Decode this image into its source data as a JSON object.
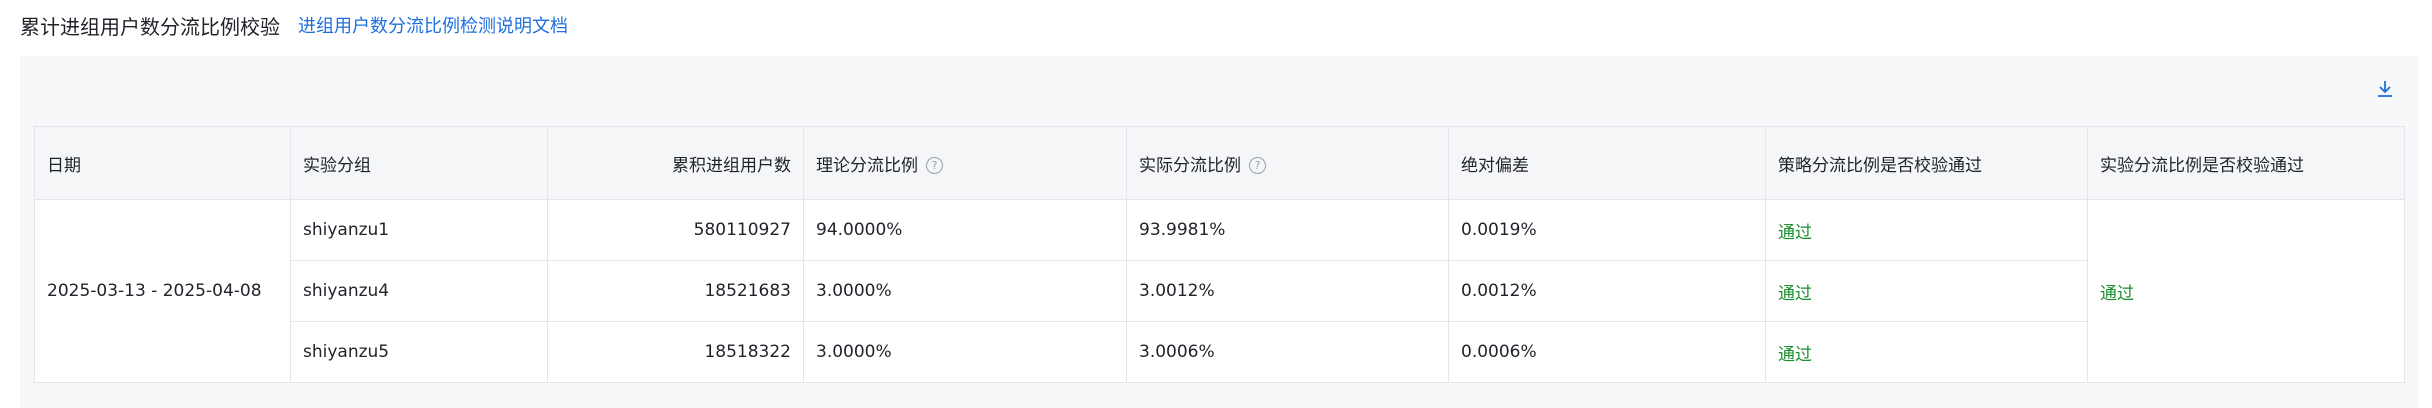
{
  "header": {
    "title": "累计进组用户数分流比例校验",
    "doc_link": "进组用户数分流比例检测说明文档"
  },
  "table": {
    "columns": [
      "日期",
      "实验分组",
      "累积进组用户数",
      "理论分流比例",
      "实际分流比例",
      "绝对偏差",
      "策略分流比例是否校验通过",
      "实验分流比例是否校验通过"
    ],
    "date_range": "2025-03-13 - 2025-04-08",
    "experiment_pass": "通过",
    "rows": [
      {
        "group": "shiyanzu1",
        "users": "580110927",
        "theory": "94.0000%",
        "actual": "93.9981%",
        "deviation": "0.0019%",
        "strategy_pass": "通过"
      },
      {
        "group": "shiyanzu4",
        "users": "18521683",
        "theory": "3.0000%",
        "actual": "3.0012%",
        "deviation": "0.0012%",
        "strategy_pass": "通过"
      },
      {
        "group": "shiyanzu5",
        "users": "18518322",
        "theory": "3.0000%",
        "actual": "3.0006%",
        "deviation": "0.0006%",
        "strategy_pass": "通过"
      }
    ]
  },
  "icons": {
    "download": "download-icon",
    "help": "help-circle-icon"
  },
  "colors": {
    "link": "#1f6fde",
    "pass": "#1a8f2c",
    "border": "#e3e5e8",
    "header_bg": "#f5f6f7"
  }
}
